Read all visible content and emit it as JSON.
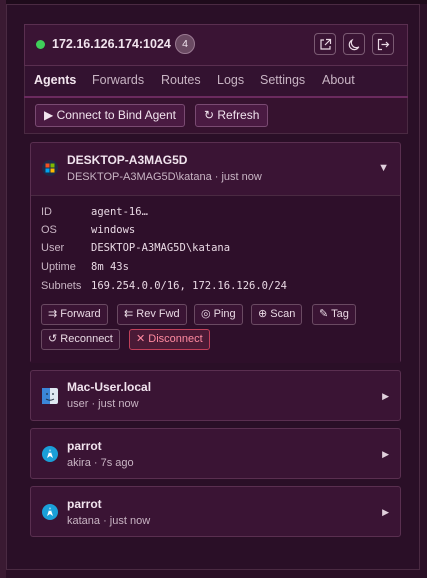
{
  "header": {
    "address": "172.16.126.174:1024",
    "agent_count": "4"
  },
  "nav": {
    "tabs": [
      "Agents",
      "Forwards",
      "Routes",
      "Logs",
      "Settings",
      "About"
    ],
    "active": "Agents"
  },
  "toolbar": {
    "connect_label": "▶ Connect to Bind Agent",
    "refresh_label": "↻ Refresh"
  },
  "agents": [
    {
      "name": "DESKTOP-A3MAG5D",
      "subtitle": "DESKTOP-A3MAG5D\\katana · just now",
      "os_icon": "windows-icon",
      "caret": "▼",
      "details": {
        "id_label": "ID",
        "id": "agent-16…",
        "os_label": "OS",
        "os": "windows",
        "user_label": "User",
        "user": "DESKTOP-A3MAG5D\\katana",
        "uptime_label": "Uptime",
        "uptime": "8m 43s",
        "subnets_label": "Subnets",
        "subnets": "169.254.0.0/16, 172.16.126.0/24"
      },
      "actions": {
        "forward": "⇉ Forward",
        "rev_fwd": "⇇ Rev Fwd",
        "ping": "◎ Ping",
        "scan": "⊕ Scan",
        "tag": "✎ Tag",
        "reconnect": "↺ Reconnect",
        "disconnect": "✕ Disconnect"
      }
    },
    {
      "name": "Mac-User.local",
      "subtitle": "user · just now",
      "os_icon": "finder-icon",
      "caret": "▶"
    },
    {
      "name": "parrot",
      "subtitle": "akira · 7s ago",
      "os_icon": "parrot-icon",
      "caret": "▶"
    },
    {
      "name": "parrot",
      "subtitle": "katana · just now",
      "os_icon": "parrot-icon",
      "caret": "▶"
    }
  ],
  "colors": {
    "online": "#3fcf5a",
    "accent": "#6a2a5e",
    "danger": "#c0405a"
  }
}
